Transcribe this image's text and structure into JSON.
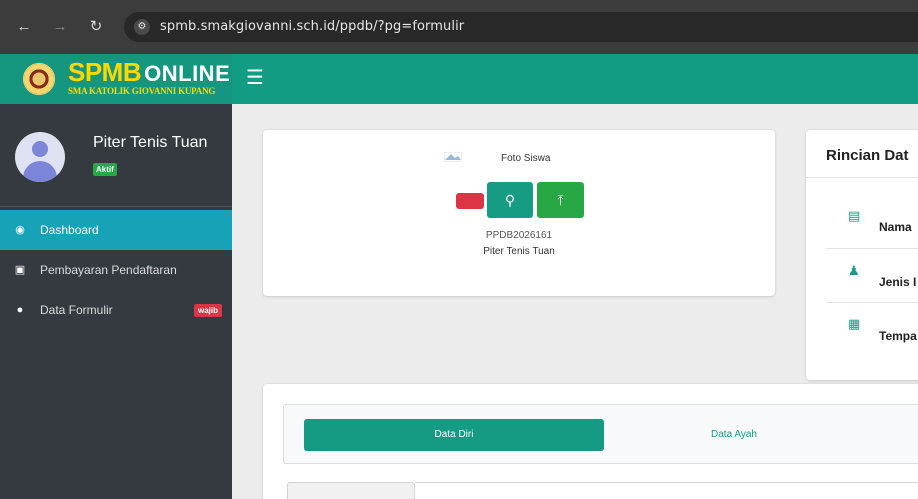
{
  "browser": {
    "url": "spmb.smakgiovanni.sch.id/ppdb/?pg=formulir"
  },
  "brand": {
    "spmb": "SPMB",
    "online": "ONLINE",
    "school": "SMA KATOLIK GIOVANNI KUPANG"
  },
  "user": {
    "name": "Piter Tenis Tuan",
    "status": "Aktif"
  },
  "sidebar": {
    "items": [
      {
        "label": "Dashboard",
        "icon": "dashboard-icon",
        "active": true
      },
      {
        "label": "Pembayaran Pendaftaran",
        "icon": "money-icon"
      },
      {
        "label": "Data Formulir",
        "icon": "user-circle-icon",
        "badge": "wajib"
      }
    ]
  },
  "photo_card": {
    "photo_label": "Foto Siswa",
    "registration_number": "PPDB2026161",
    "student_name": "Piter Tenis Tuan"
  },
  "rincian": {
    "title": "Rincian Dat",
    "rows": [
      {
        "label": "Nama",
        "icon": "book-icon"
      },
      {
        "label": "Jenis I",
        "icon": "users-icon"
      },
      {
        "label": "Tempa",
        "icon": "calendar-icon"
      }
    ]
  },
  "form": {
    "tabs": [
      {
        "label": "Data Diri",
        "active": true
      },
      {
        "label": "Data Ayah"
      }
    ]
  },
  "colors": {
    "primary": "#15967f",
    "sidebar": "#343a40",
    "active_menu": "#17a2b8",
    "danger": "#dc3545",
    "success": "#28a745"
  }
}
